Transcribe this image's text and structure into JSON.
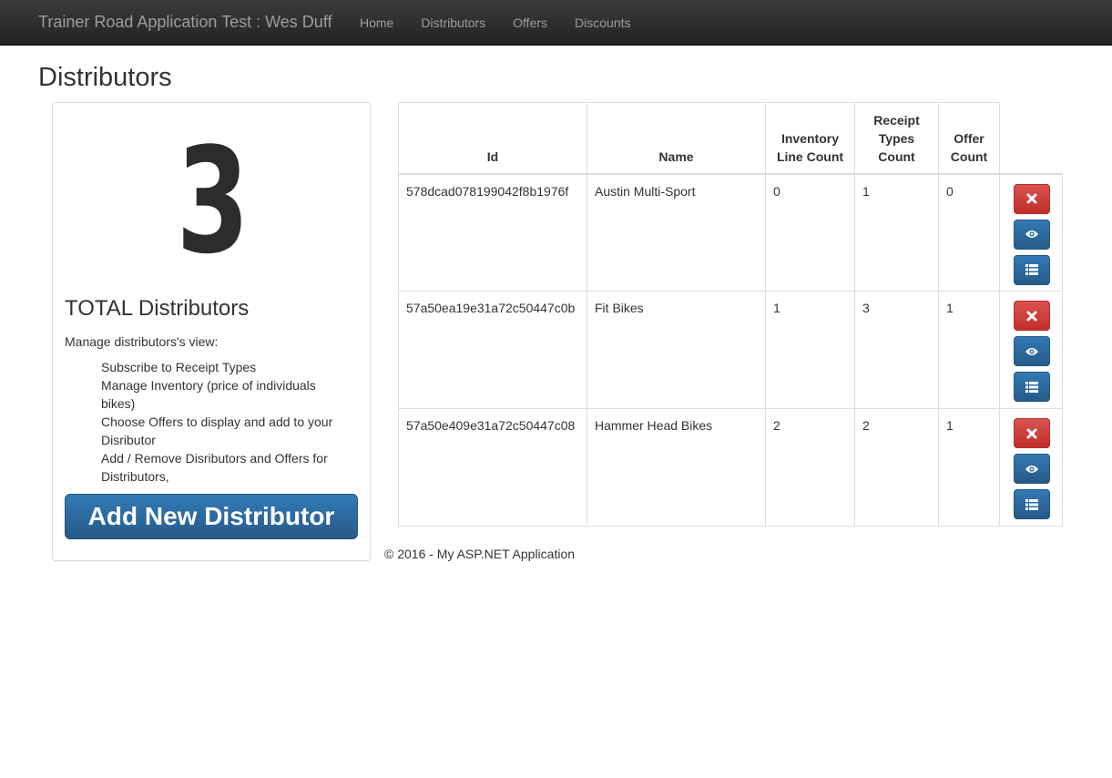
{
  "navbar": {
    "brand": "Trainer Road Application Test : Wes Duff",
    "links": [
      "Home",
      "Distributors",
      "Offers",
      "Discounts"
    ]
  },
  "page": {
    "title": "Distributors"
  },
  "summary": {
    "count": "3",
    "label": "TOTAL Distributors",
    "intro": "Manage distributors's view:",
    "features": [
      "Subscribe to Receipt Types",
      "Manage Inventory (price of individuals bikes)",
      "Choose Offers to display and add to your Disributor",
      "Add / Remove Disributors and Offers for Distributors,"
    ],
    "add_button": "Add New Distributor"
  },
  "table": {
    "headers": {
      "id": "Id",
      "name": "Name",
      "inventory": "Inventory Line Count",
      "receipt": "Receipt Types Count",
      "offer": "Offer Count"
    },
    "rows": [
      {
        "id": "578dcad078199042f8b1976f",
        "name": "Austin Multi-Sport",
        "inventory": "0",
        "receipt": "1",
        "offer": "0"
      },
      {
        "id": "57a50ea19e31a72c50447c0b",
        "name": "Fit Bikes",
        "inventory": "1",
        "receipt": "3",
        "offer": "1"
      },
      {
        "id": "57a50e409e31a72c50447c08",
        "name": "Hammer Head Bikes",
        "inventory": "2",
        "receipt": "2",
        "offer": "1"
      }
    ],
    "action_icons": [
      "remove-icon",
      "eye-icon",
      "list-icon"
    ]
  },
  "footer": {
    "text": "© 2016 - My ASP.NET Application"
  },
  "colors": {
    "navbar": "#222222",
    "nav_text": "#9d9d9d",
    "primary": "#337ab7",
    "danger": "#d9534f"
  }
}
